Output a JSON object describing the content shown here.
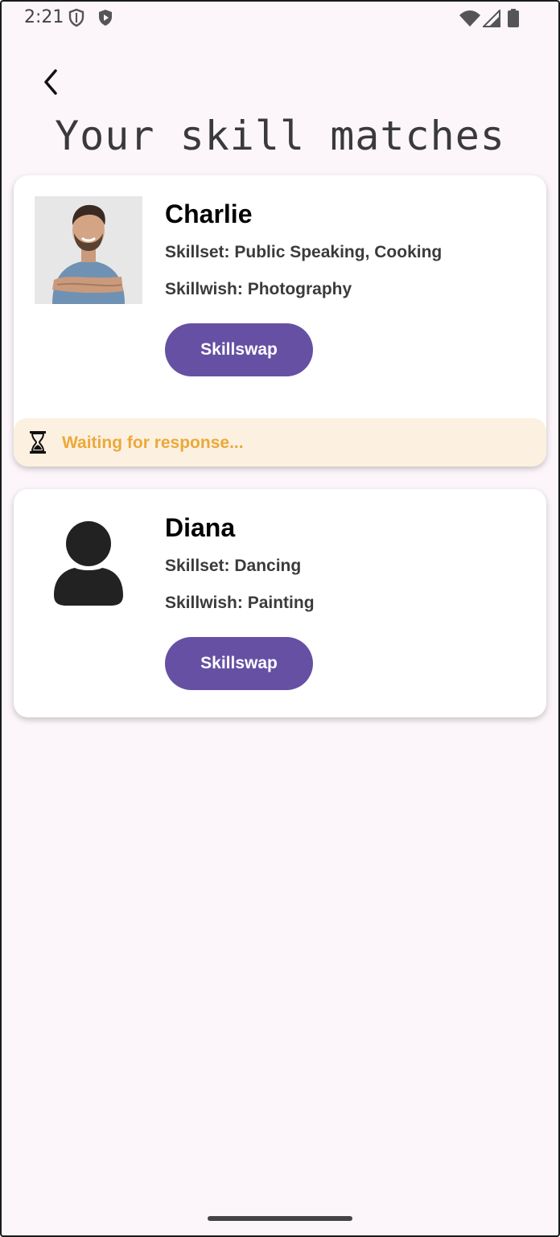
{
  "status_bar": {
    "time": "2:21",
    "icons": [
      "shield-outline-icon",
      "play-shield-icon",
      "wifi-icon",
      "signal-icon",
      "battery-icon"
    ]
  },
  "header": {
    "back_icon": "chevron-left-icon",
    "title": "Your skill matches"
  },
  "matches": [
    {
      "name": "Charlie",
      "avatar": "profile-photo",
      "skillset": "Skillset: Public Speaking, Cooking",
      "skillwish": "Skillwish: Photography",
      "button_label": "Skillswap",
      "status": "Waiting for response...",
      "status_icon": "hourglass-icon"
    },
    {
      "name": "Diana",
      "avatar": "person-placeholder-icon",
      "skillset": "Skillset: Dancing",
      "skillwish": "Skillwish: Painting",
      "button_label": "Skillswap"
    }
  ],
  "colors": {
    "background": "#fcf6fb",
    "accent": "#6650a4",
    "waiting_bg": "#fcf1e0",
    "waiting_text": "#eca83a"
  }
}
